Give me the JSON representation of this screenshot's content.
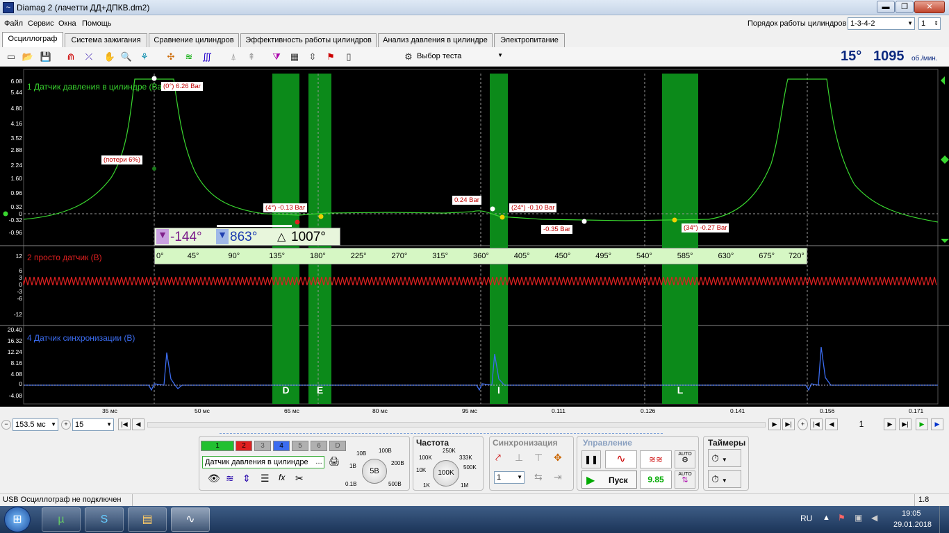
{
  "window": {
    "title": "Diamag 2 (лачетти ДД+ДПКВ.dm2)",
    "min": "▬",
    "max": "❐",
    "close": "✕"
  },
  "menu": [
    "Файл",
    "Сервис",
    "Окна",
    "Помощь"
  ],
  "firing_order": {
    "label": "Порядок работы цилиндров",
    "value": "1-3-4-2",
    "cylinder": "1"
  },
  "tabs": [
    "Осциллограф",
    "Система зажигания",
    "Сравнение цилиндров",
    "Эффективность работы цилиндров",
    "Анализ давления в цилиндре",
    "Электропитание"
  ],
  "toolbar": {
    "test_select": "Выбор теста",
    "angle": "15°",
    "rpm": "1095",
    "rpm_unit": "об./мин."
  },
  "channels": [
    {
      "name": "1 Датчик давления в цилиндре (Bar)",
      "color": "#39d62f",
      "ticks": [
        "6.08",
        "5.44",
        "4.80",
        "4.16",
        "3.52",
        "2.88",
        "2.24",
        "1.60",
        "0.96",
        "0.32",
        "0",
        "-0.32",
        "-0.96"
      ]
    },
    {
      "name": "2 просто датчик (В)",
      "color": "#e02020",
      "ticks": [
        "12",
        "6",
        "3",
        "0",
        "-3",
        "-6",
        "-12"
      ]
    },
    {
      "name": "4 Датчик синхронизации (В)",
      "color": "#3b6cf0",
      "ticks": [
        "20.40",
        "16.32",
        "12.24",
        "8.16",
        "4.08",
        "0",
        "-4.08"
      ]
    }
  ],
  "annotations": {
    "peak": "(0°) 6.26 Bar",
    "losses": "(потери 6%)",
    "a4": "(4°) -0.13 Bar",
    "a024": "0.24 Bar",
    "a24": "(24°) -0.10 Bar",
    "a035": "-0.35 Bar",
    "a34": "(34°) -0.27 Bar"
  },
  "cursors": {
    "left": "-144°",
    "right": "863°",
    "delta": "1007°"
  },
  "angle_scale": [
    "0°",
    "45°",
    "90°",
    "135°",
    "180°",
    "225°",
    "270°",
    "315°",
    "360°",
    "405°",
    "450°",
    "495°",
    "540°",
    "585°",
    "630°",
    "675°",
    "720°"
  ],
  "zones": [
    "D",
    "E",
    "I",
    "L"
  ],
  "time_axis": [
    "35 мс",
    "50 мс",
    "65 мс",
    "80 мс",
    "95 мс",
    "0.111",
    "0.126",
    "0.141",
    "0.156",
    "0.171"
  ],
  "navigation": {
    "timebase": "153.5 мс",
    "zoom": "15",
    "page": "1"
  },
  "controls": {
    "channel_buttons": [
      "1",
      "2",
      "3",
      "4",
      "5",
      "6",
      "D"
    ],
    "channel_name": "Датчик давления в цилиндре",
    "scale_labels": [
      "10В",
      "100В",
      "1В",
      "200В",
      "0.1В",
      "500В"
    ],
    "scale_value": "5В",
    "freq_title": "Частота",
    "freq_labels": [
      "250K",
      "100K",
      "333K",
      "10K",
      "500K",
      "1K",
      "1M"
    ],
    "freq_value": "100K",
    "sync_title": "Синхронизация",
    "sync_value": "1",
    "control_title": "Управление",
    "start": "Пуск",
    "value": "9.85",
    "auto": "AUTO",
    "timers_title": "Таймеры"
  },
  "status": {
    "text": "USB Осциллограф не подключен",
    "version": "1.8"
  },
  "taskbar": {
    "lang": "RU",
    "time": "19:05",
    "date": "29.01.2018"
  }
}
